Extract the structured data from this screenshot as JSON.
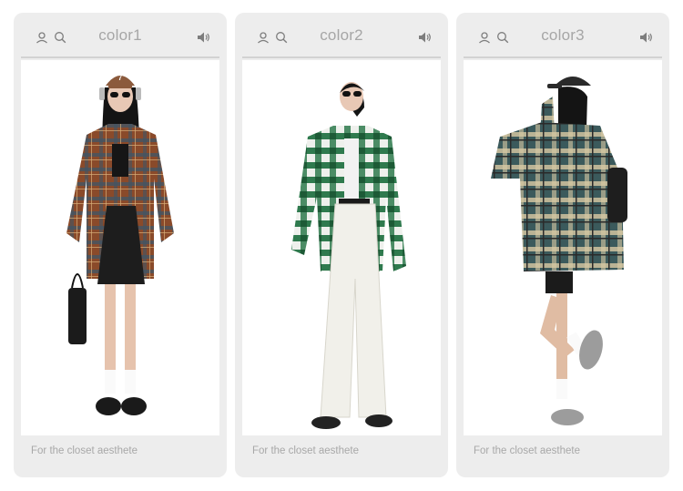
{
  "cards": [
    {
      "title": "color1",
      "caption": "For the closet aesthete",
      "colors": {
        "shirt_primary": "#8a4a2a",
        "shirt_secondary": "#3f5566",
        "bottom": "#1d1d1d",
        "shoes": "#1a1a1a",
        "cap": "#8b5a3c"
      }
    },
    {
      "title": "color2",
      "caption": "For the closet aesthete",
      "colors": {
        "shirt_primary": "#2f7a4e",
        "shirt_secondary": "#eef0ec",
        "bottom": "#f1f0ea",
        "shoes": "#222222"
      }
    },
    {
      "title": "color3",
      "caption": "For the closet aesthete",
      "colors": {
        "shirt_primary": "#3b5a5c",
        "shirt_secondary": "#d9c9a4",
        "bottom": "#1b1b1b",
        "shoes": "#9c9c9c",
        "cap": "#2a2a2a"
      }
    }
  ],
  "icons": {
    "user": "user-icon",
    "search": "search-icon",
    "speaker": "speaker-icon"
  }
}
